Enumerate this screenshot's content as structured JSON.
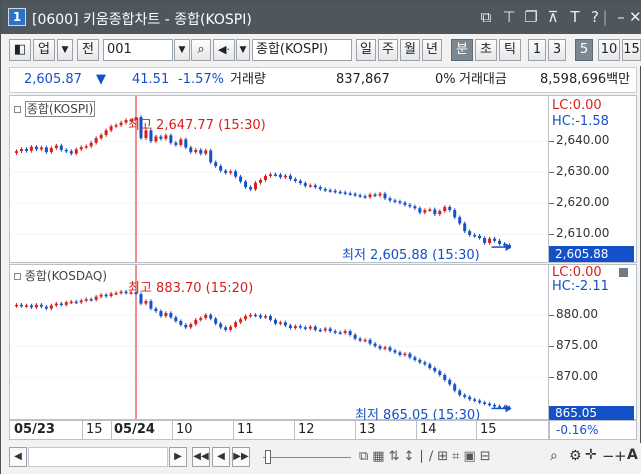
{
  "window": {
    "number": "1",
    "title": "[0600] 키움종합차트 - 종합(KOSPI)"
  },
  "toolbar": {
    "market": "업",
    "full": "전",
    "code": "001",
    "symbol_name": "종합(KOSPI)",
    "periods": [
      "일",
      "주",
      "월",
      "년",
      "분",
      "초",
      "틱"
    ],
    "active_period": "분",
    "intervals": [
      "1",
      "3",
      "5",
      "10",
      "15"
    ],
    "active_interval": "5"
  },
  "quote": {
    "price": "2,605.87",
    "direction_arrow": "▼",
    "change": "41.51",
    "change_pct": "-1.57%",
    "volume_label": "거래량",
    "volume": "837,867",
    "volume_pct": "0%",
    "amount_label": "거래대금",
    "amount": "8,598,696백만"
  },
  "panel_kospi": {
    "title": "종합(KOSPI)",
    "lc": "LC:0.00",
    "hc": "HC:-1.58",
    "high_label": "최고 2,647.77 (15:30)",
    "low_label": "최저 2,605.88 (15:30)",
    "current_value": "2,605.88",
    "axis_labels": [
      "2,640.00",
      "2,630.00",
      "2,620.00",
      "2,610.00"
    ]
  },
  "panel_kosdaq": {
    "title": "종합(KOSDAQ)",
    "lc": "LC:0.00",
    "hc": "HC:-2.11",
    "high_label": "최고 883.70 (15:20)",
    "low_label": "최저 865.05 (15:30)",
    "current_value": "865.05",
    "current_pct": "-0.16%",
    "axis_labels": [
      "880.00",
      "875.00",
      "870.00"
    ]
  },
  "xaxis": {
    "labels": [
      "05/23",
      "15",
      "05/24",
      "10",
      "11",
      "12",
      "13",
      "14",
      "15"
    ]
  },
  "chart_data": [
    {
      "type": "candlestick",
      "title": "종합(KOSPI)",
      "ylim": [
        2603,
        2652
      ],
      "yticks": [
        2640,
        2630,
        2620,
        2610
      ],
      "series": [
        {
          "values": [
            2636.8,
            2637.5,
            2636.9,
            2638.2,
            2637.4,
            2638.0,
            2636.5,
            2637.8,
            2638.6,
            2637.2,
            2636.8,
            2636.0,
            2637.4,
            2638.1,
            2638.4,
            2639.5,
            2641.0,
            2642.0,
            2643.5,
            2644.8,
            2645.2,
            2646.0,
            2646.8,
            2646.9,
            2647.77,
            2641.0,
            2643.5,
            2640.0,
            2641.5,
            2640.8,
            2641.9,
            2639.5,
            2638.8,
            2640.6,
            2638.0,
            2636.5,
            2637.2,
            2636.0,
            2637.0,
            2633.2,
            2632.0,
            2630.5,
            2629.8,
            2630.3,
            2628.6,
            2627.0,
            2625.2,
            2624.5,
            2626.6,
            2627.5,
            2628.8,
            2629.3,
            2629.2,
            2628.4,
            2628.9,
            2627.8,
            2627.2,
            2626.5,
            2625.6,
            2625.8,
            2625.2,
            2624.6,
            2624.2,
            2624.0,
            2623.7,
            2623.5,
            2623.2,
            2623.0,
            2622.6,
            2622.3,
            2622.0,
            2622.8,
            2622.5,
            2623.1,
            2621.6,
            2620.9,
            2620.6,
            2620.2,
            2619.5,
            2619.0,
            2618.4,
            2617.0,
            2617.8,
            2618.0,
            2616.5,
            2617.5,
            2618.8,
            2617.8,
            2615.5,
            2613.5,
            2611.0,
            2609.8,
            2609.5,
            2608.8,
            2607.2,
            2608.6,
            2607.9,
            2606.9,
            2606.5,
            2605.88
          ],
          "opens": [
            2636.2,
            2636.8,
            2637.5,
            2636.9,
            2638.2,
            2637.4,
            2638.0,
            2636.5,
            2637.8,
            2638.6,
            2637.2,
            2636.8,
            2636.0,
            2637.4,
            2638.1,
            2638.4,
            2639.5,
            2641.0,
            2642.0,
            2643.5,
            2644.8,
            2645.2,
            2646.0,
            2646.8,
            2646.9,
            2647.8,
            2641.0,
            2643.5,
            2640.0,
            2641.5,
            2640.8,
            2641.9,
            2639.5,
            2638.8,
            2640.6,
            2638.0,
            2636.5,
            2637.2,
            2636.0,
            2637.0,
            2633.2,
            2632.0,
            2630.5,
            2629.8,
            2630.3,
            2628.6,
            2627.0,
            2625.2,
            2624.5,
            2626.6,
            2627.5,
            2628.8,
            2629.3,
            2629.2,
            2628.4,
            2628.9,
            2627.8,
            2627.2,
            2626.5,
            2625.6,
            2625.8,
            2625.2,
            2624.6,
            2624.2,
            2624.0,
            2623.7,
            2623.5,
            2623.2,
            2623.0,
            2622.6,
            2622.3,
            2622.0,
            2622.8,
            2622.5,
            2623.1,
            2621.6,
            2620.9,
            2620.6,
            2620.2,
            2619.5,
            2619.0,
            2618.4,
            2617.0,
            2617.8,
            2618.0,
            2616.5,
            2617.5,
            2618.8,
            2617.8,
            2615.5,
            2613.5,
            2611.0,
            2609.8,
            2609.5,
            2608.8,
            2607.2,
            2608.6,
            2607.9,
            2606.9,
            2606.5
          ]
        }
      ]
    },
    {
      "type": "candlestick",
      "title": "종합(KOSDAQ)",
      "ylim": [
        864,
        887
      ],
      "yticks": [
        880,
        875,
        870
      ],
      "series": [
        {
          "values": [
            881.6,
            881.4,
            881.5,
            881.2,
            881.6,
            881.3,
            881.0,
            881.5,
            881.8,
            881.6,
            882.0,
            882.1,
            882.0,
            882.3,
            882.5,
            882.4,
            882.9,
            883.2,
            883.0,
            883.4,
            883.5,
            883.7,
            883.5,
            883.6,
            883.3,
            881.8,
            882.2,
            881.0,
            880.6,
            879.8,
            880.3,
            879.6,
            879.0,
            878.4,
            878.0,
            878.5,
            879.2,
            879.5,
            880.0,
            879.4,
            878.6,
            878.0,
            877.6,
            878.1,
            878.8,
            879.3,
            879.8,
            880.0,
            879.9,
            879.6,
            879.8,
            879.2,
            878.6,
            878.8,
            878.3,
            877.9,
            878.2,
            878.0,
            877.8,
            878.1,
            877.6,
            877.5,
            877.8,
            877.4,
            877.2,
            877.1,
            877.4,
            876.8,
            876.2,
            875.9,
            876.0,
            875.4,
            875.0,
            874.6,
            874.8,
            874.3,
            874.0,
            873.6,
            873.8,
            873.2,
            872.8,
            872.4,
            872.1,
            871.5,
            871.0,
            870.4,
            869.6,
            868.9,
            867.9,
            867.2,
            866.9,
            866.5,
            866.3,
            866.0,
            865.8,
            865.6,
            865.4,
            865.3,
            865.2,
            865.05
          ],
          "opens": [
            881.4,
            881.6,
            881.4,
            881.5,
            881.2,
            881.6,
            881.3,
            881.0,
            881.5,
            881.8,
            881.6,
            882.0,
            882.1,
            882.0,
            882.3,
            882.5,
            882.4,
            882.9,
            883.2,
            883.0,
            883.4,
            883.5,
            883.7,
            883.5,
            883.6,
            883.3,
            881.8,
            882.2,
            881.0,
            880.6,
            879.8,
            880.3,
            879.6,
            879.0,
            878.4,
            878.0,
            878.5,
            879.2,
            879.5,
            880.0,
            879.4,
            878.6,
            878.0,
            877.6,
            878.1,
            878.8,
            879.3,
            879.8,
            880.0,
            879.9,
            879.6,
            879.8,
            879.2,
            878.6,
            878.8,
            878.3,
            877.9,
            878.2,
            878.0,
            877.8,
            878.1,
            877.6,
            877.5,
            877.8,
            877.4,
            877.2,
            877.1,
            877.4,
            876.8,
            876.2,
            875.9,
            876.0,
            875.4,
            875.0,
            874.6,
            874.8,
            874.3,
            874.0,
            873.6,
            873.8,
            873.2,
            872.8,
            872.4,
            872.1,
            871.5,
            871.0,
            870.4,
            869.6,
            868.9,
            867.9,
            867.2,
            866.9,
            866.5,
            866.3,
            866.0,
            865.8,
            865.6,
            865.4,
            865.3,
            865.2
          ]
        }
      ]
    }
  ],
  "colors": {
    "up": "#d8201b",
    "down": "#1450c8",
    "titlebar": "#4f575e",
    "selected_btn": "#7a8893"
  }
}
